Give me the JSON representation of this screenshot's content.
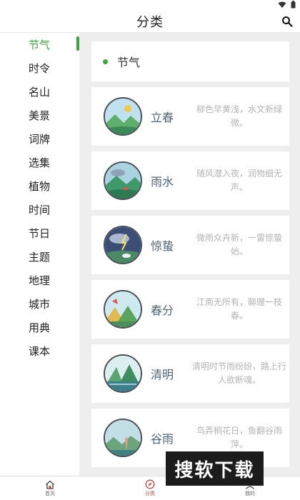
{
  "header": {
    "title": "分类"
  },
  "sidebar": {
    "items": [
      {
        "label": "节气",
        "active": true
      },
      {
        "label": "时令"
      },
      {
        "label": "名山"
      },
      {
        "label": "美景"
      },
      {
        "label": "词牌"
      },
      {
        "label": "选集"
      },
      {
        "label": "植物"
      },
      {
        "label": "时间"
      },
      {
        "label": "节日"
      },
      {
        "label": "主题"
      },
      {
        "label": "地理"
      },
      {
        "label": "城市"
      },
      {
        "label": "用典"
      },
      {
        "label": "课本"
      }
    ]
  },
  "main": {
    "section_title": "节气",
    "items": [
      {
        "name": "立春",
        "verse": "柳色早黄浅，水文新绿微。",
        "tag": "立春"
      },
      {
        "name": "雨水",
        "verse": "随风潜入夜，润物细无声。",
        "tag": "雨水"
      },
      {
        "name": "惊蛰",
        "verse": "微雨众卉新，一雷惊蛰始。",
        "tag": "惊蛰"
      },
      {
        "name": "春分",
        "verse": "江南无所有，聊赠一枝春。",
        "tag": "春分"
      },
      {
        "name": "清明",
        "verse": "清明时节雨纷纷，路上行人欲断魂。",
        "tag": "清明"
      },
      {
        "name": "谷雨",
        "verse": "鸟弄桐花日，鱼翻谷雨萍。",
        "tag": "谷雨"
      }
    ]
  },
  "bottom_nav": {
    "items": [
      {
        "label": "首页",
        "icon": "home-icon"
      },
      {
        "label": "分类",
        "icon": "compass-icon",
        "active": true
      },
      {
        "label": "我的",
        "icon": "user-icon"
      }
    ]
  },
  "watermark": "搜软下载",
  "colors": {
    "accent": "#3aa63a",
    "nav_active": "#c24b3a"
  }
}
